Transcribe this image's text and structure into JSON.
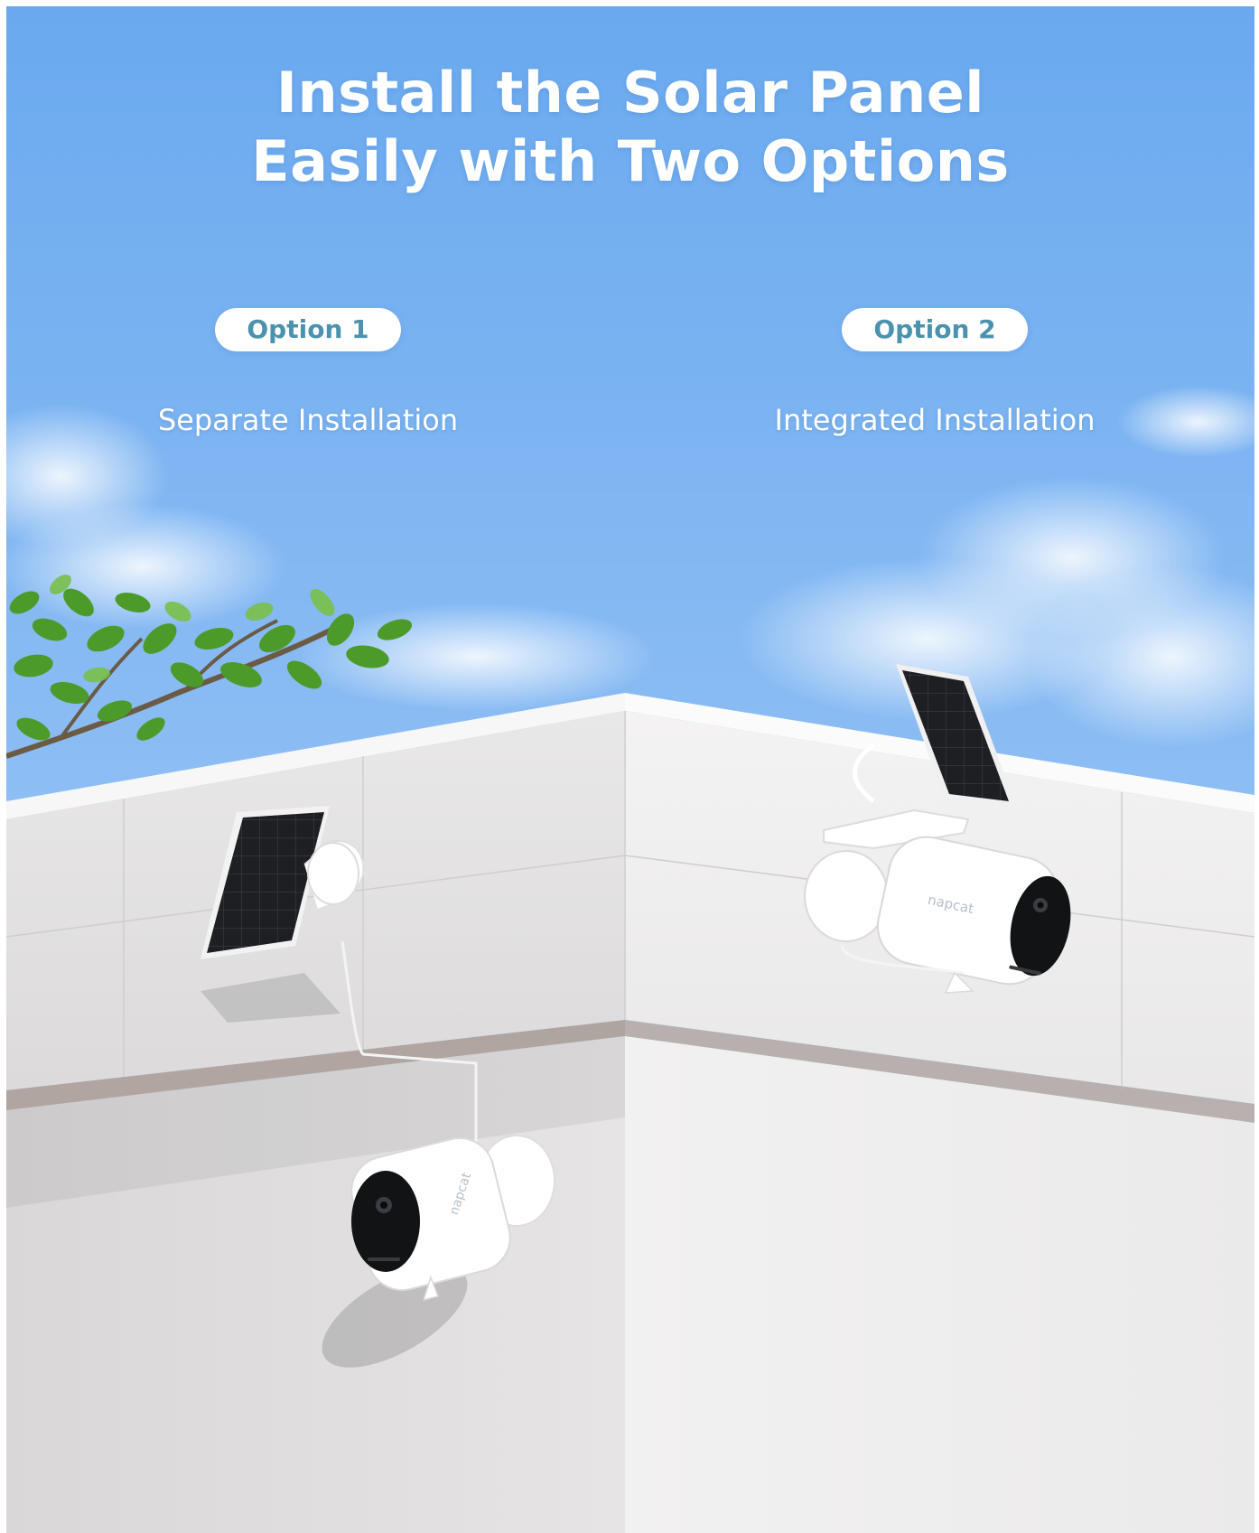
{
  "headline": {
    "line1": "Install the Solar Panel",
    "line2": "Easily with Two Options"
  },
  "options": [
    {
      "badge": "Option 1",
      "title": "Separate Installation"
    },
    {
      "badge": "Option 2",
      "title": "Integrated Installation"
    }
  ],
  "camera_brand": "napcat",
  "colors": {
    "sky_top": "#6aa9ef",
    "sky_bottom": "#a9d1f7",
    "badge_text": "#4a92ad",
    "wall": "#ecebeb",
    "leaf": "#4c9b2a"
  }
}
